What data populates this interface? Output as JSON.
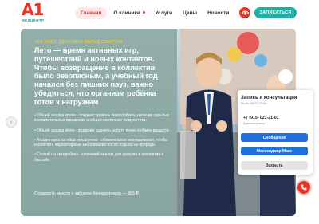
{
  "brand": {
    "logo_main": "A1",
    "logo_sub": "МЕДЦЕНТР"
  },
  "nav": {
    "items": [
      {
        "label": "Главная",
        "active": true
      },
      {
        "label": "О клинике",
        "has_dot": true
      },
      {
        "label": "Услуги"
      },
      {
        "label": "Цены"
      },
      {
        "label": "Новости"
      }
    ]
  },
  "header": {
    "cta_label": "ЗАПИСАТЬСЯ",
    "accessibility_icon": "eye-icon"
  },
  "hero": {
    "eyebrow": "ЧЕК-ЛИСТ ЗДОРОВЬЯ ПЕРЕД СТАРТОМ",
    "headline": "Лето — время активных игр, путешествий и новых контактов. Чтобы возвращение в коллектив было безопасным, а учебный год начался без лишних пауз, важно убедиться, что организм ребёнка готов к нагрузкам",
    "bullets": [
      "• Общий анализ крови - покажет уровень гемоглобина, наличие скрытых воспалительных процессов и общее состояние иммунитета.",
      "• Общий анализ мочи - позволит оценить работу почек и обмен веществ.",
      "• Анализ кала на яйца гельминтов - обязательное исследование, чтобы исключить паразитарные заболевания после отдыха на природе.",
      "• Соскоб на энтеробиоз - ключевой анализ для допуска в коллектив и бассейн."
    ],
    "price": "Стоимость вместе с забором биоматериала — 865 ₽"
  },
  "widget": {
    "title": "Запись и консультация",
    "hours": "Пн-Вс 08:00-22:00",
    "phone": "+7 (915) 021-21-01",
    "role": "Администратор",
    "btn_message": "Сообщение",
    "btn_messenger": "Мессенджер Макс",
    "btn_close": "Закрыть"
  },
  "colors": {
    "accent_red": "#e8332a",
    "brand_teal": "#1ab0a3",
    "button_blue": "#1f6fe0",
    "eyebrow_yellow": "#f4d73e"
  }
}
